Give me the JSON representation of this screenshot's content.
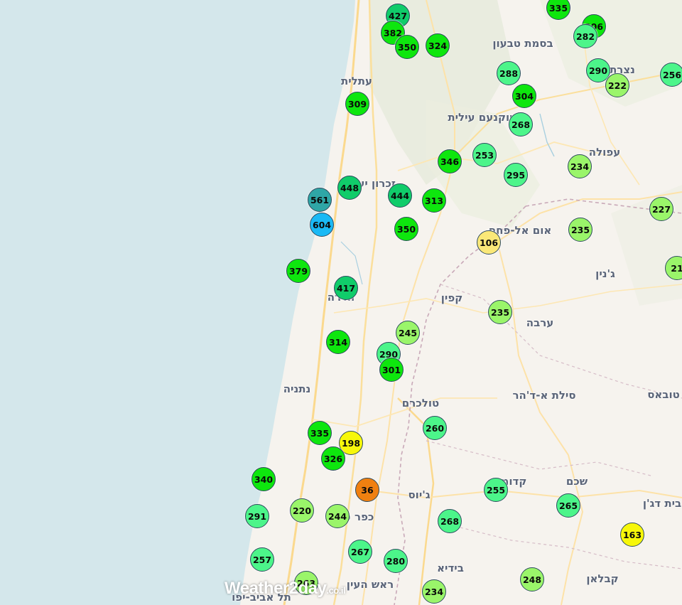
{
  "brand": {
    "logo_text": "Weather2day",
    "logo_tld": ".co.il"
  },
  "scale_colors": {
    "blue": "#1ab9f5",
    "teal": "#2fa6a6",
    "dark_green": "#10cc6a",
    "green": "#0ee60e",
    "mint": "#4cf58a",
    "light_green": "#9af56a",
    "pale_yellow": "#fae878",
    "yellow": "#f7f70a",
    "orange": "#f08010"
  },
  "places": [
    {
      "name": "בסמת טבעון"
    },
    {
      "name": "עתלית"
    },
    {
      "name": "נצרת"
    },
    {
      "name": "יוקנעם עילית"
    },
    {
      "name": "עפולה"
    },
    {
      "name": "זכרון יעקב"
    },
    {
      "name": "אום אל-פחם"
    },
    {
      "name": "ג'נין"
    },
    {
      "name": "קפין"
    },
    {
      "name": "חדרה"
    },
    {
      "name": "ערבה"
    },
    {
      "name": "נתניה"
    },
    {
      "name": "סילת א-ד'הר"
    },
    {
      "name": "טובאס"
    },
    {
      "name": "טולכרם"
    },
    {
      "name": "קדומים"
    },
    {
      "name": "שכם"
    },
    {
      "name": "ג'יוס"
    },
    {
      "name": "בית דג'ן"
    },
    {
      "name": "כפר סבא"
    },
    {
      "name": "בידיא"
    },
    {
      "name": "ראש העין"
    },
    {
      "name": "קבלאן"
    },
    {
      "name": "תל אביב-יפו"
    }
  ],
  "stations": [
    {
      "value": "427",
      "color": "dark_green"
    },
    {
      "value": "382",
      "color": "green"
    },
    {
      "value": "350",
      "color": "green"
    },
    {
      "value": "324",
      "color": "green"
    },
    {
      "value": "335",
      "color": "green"
    },
    {
      "value": "306",
      "color": "green"
    },
    {
      "value": "282",
      "color": "mint"
    },
    {
      "value": "288",
      "color": "mint"
    },
    {
      "value": "290",
      "color": "mint"
    },
    {
      "value": "222",
      "color": "light_green"
    },
    {
      "value": "256",
      "color": "mint"
    },
    {
      "value": "304",
      "color": "green"
    },
    {
      "value": "309",
      "color": "green"
    },
    {
      "value": "268",
      "color": "mint"
    },
    {
      "value": "253",
      "color": "mint"
    },
    {
      "value": "346",
      "color": "green"
    },
    {
      "value": "295",
      "color": "mint"
    },
    {
      "value": "234",
      "color": "light_green"
    },
    {
      "value": "448",
      "color": "dark_green"
    },
    {
      "value": "444",
      "color": "dark_green"
    },
    {
      "value": "313",
      "color": "green"
    },
    {
      "value": "561",
      "color": "teal"
    },
    {
      "value": "604",
      "color": "blue"
    },
    {
      "value": "227",
      "color": "light_green"
    },
    {
      "value": "350",
      "color": "green"
    },
    {
      "value": "235",
      "color": "light_green"
    },
    {
      "value": "106",
      "color": "pale_yellow"
    },
    {
      "value": "21",
      "color": "light_green"
    },
    {
      "value": "379",
      "color": "green"
    },
    {
      "value": "417",
      "color": "dark_green"
    },
    {
      "value": "235",
      "color": "light_green"
    },
    {
      "value": "245",
      "color": "light_green"
    },
    {
      "value": "314",
      "color": "green"
    },
    {
      "value": "290",
      "color": "mint"
    },
    {
      "value": "301",
      "color": "green"
    },
    {
      "value": "260",
      "color": "mint"
    },
    {
      "value": "335",
      "color": "green"
    },
    {
      "value": "198",
      "color": "yellow"
    },
    {
      "value": "326",
      "color": "green"
    },
    {
      "value": "340",
      "color": "green"
    },
    {
      "value": "36",
      "color": "orange"
    },
    {
      "value": "255",
      "color": "mint"
    },
    {
      "value": "265",
      "color": "mint"
    },
    {
      "value": "291",
      "color": "mint"
    },
    {
      "value": "220",
      "color": "light_green"
    },
    {
      "value": "244",
      "color": "light_green"
    },
    {
      "value": "268",
      "color": "mint"
    },
    {
      "value": "163",
      "color": "yellow"
    },
    {
      "value": "257",
      "color": "mint"
    },
    {
      "value": "267",
      "color": "mint"
    },
    {
      "value": "280",
      "color": "mint"
    },
    {
      "value": "248",
      "color": "light_green"
    },
    {
      "value": "234",
      "color": "light_green"
    },
    {
      "value": "263",
      "color": "light_green"
    }
  ]
}
